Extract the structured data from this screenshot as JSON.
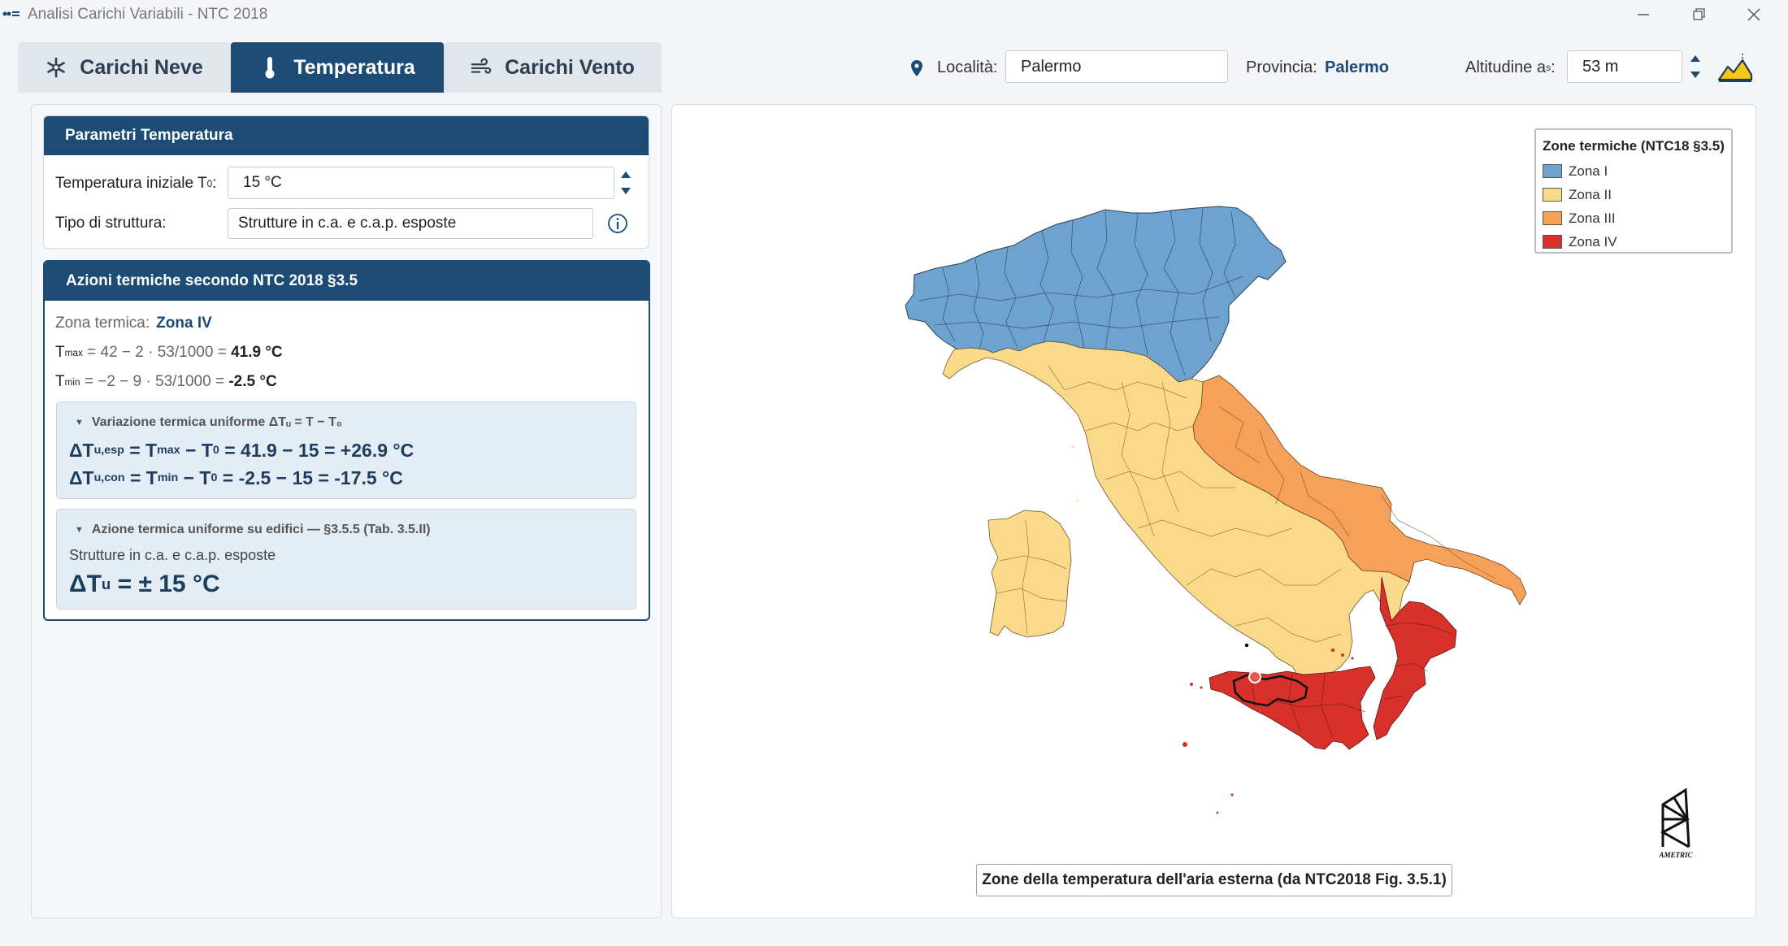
{
  "window": {
    "title": "Analisi Carichi Variabili - NTC 2018"
  },
  "tabs": [
    {
      "label": "Carichi Neve",
      "icon": "snowflake-icon"
    },
    {
      "label": "Temperatura",
      "icon": "thermometer-icon",
      "active": true
    },
    {
      "label": "Carichi Vento",
      "icon": "wind-icon"
    }
  ],
  "location": {
    "localita_label": "Località:",
    "localita_value": "Palermo",
    "provincia_label": "Provincia:",
    "provincia_value": "Palermo",
    "altitudine_label": "Altitudine a",
    "altitudine_sub": "s",
    "altitudine_colon": ":",
    "altitudine_value": "53 m"
  },
  "params": {
    "title": "Parametri Temperatura",
    "t0_label": "Temperatura iniziale T",
    "t0_sub": "0",
    "t0_colon": ":",
    "t0_value": "15 °C",
    "tipo_label": "Tipo di struttura:",
    "tipo_value": "Strutture in c.a. e c.a.p. esposte"
  },
  "azioni": {
    "title": "Azioni termiche secondo NTC 2018 §3.5",
    "zona_label": "Zona termica:",
    "zona_value": "Zona IV",
    "tmax_sym": "T",
    "tmax_sub": "max",
    "tmax_expr": " = 42 − 2 · 53/1000 = ",
    "tmax_result": "41.9 °C",
    "tmin_sym": "T",
    "tmin_sub": "min",
    "tmin_expr": " = −2 − 9 · 53/1000 = ",
    "tmin_result": "-2.5 °C",
    "variazione_title": "Variazione termica uniforme ΔTᵤ = T − T₀",
    "esp_sym": "ΔT",
    "esp_sub": "u,esp",
    "esp_eq": " = T",
    "esp_max_sub": "max",
    "esp_mid": " − T",
    "esp_zero_sub": "0",
    "esp_rest": " = 41.9 − 15 = +26.9 °C",
    "con_sym": "ΔT",
    "con_sub": "u,con",
    "con_eq": " = T",
    "con_min_sub": "min",
    "con_mid": " − T",
    "con_zero_sub": "0",
    "con_rest": " = -2.5 − 15 = -17.5 °C",
    "edifici_title": "Azione termica uniforme su edifici — §3.5.5 (Tab. 3.5.II)",
    "edifici_tipo": "Strutture in c.a. e c.a.p. esposte",
    "du_sym": "ΔT",
    "du_sub": "u",
    "du_value": " = ± 15 °C"
  },
  "legend": {
    "title": "Zone termiche (NTC18 §3.5)",
    "items": [
      {
        "label": "Zona I",
        "color": "#6fa3cf"
      },
      {
        "label": "Zona II",
        "color": "#fbd98a"
      },
      {
        "label": "Zona III",
        "color": "#f6a15a"
      },
      {
        "label": "Zona IV",
        "color": "#d8302b"
      }
    ]
  },
  "map": {
    "caption": "Zone della temperatura dell'aria esterna (da NTC2018 Fig. 3.5.1)",
    "logo_text": "AMETRIC"
  }
}
